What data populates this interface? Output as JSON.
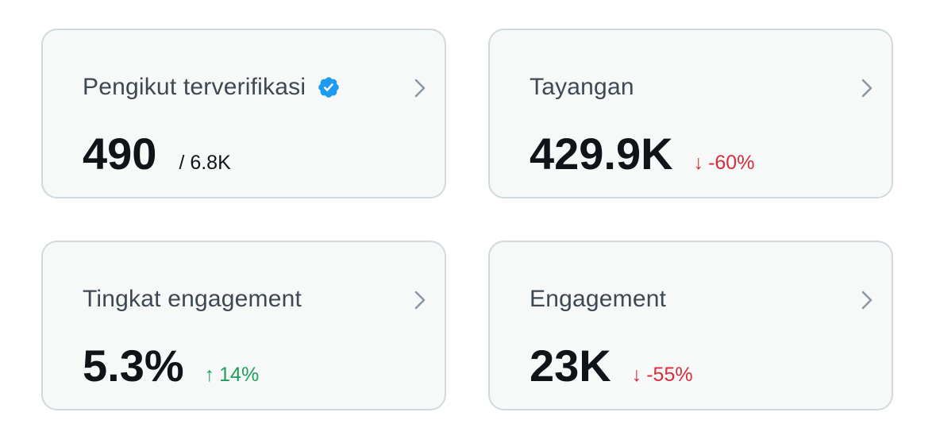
{
  "colors": {
    "card_background": "#f7f9f9",
    "card_border": "#cfd9de",
    "verified_blue": "#1d9bf0",
    "negative_red": "#d62c3b",
    "positive_green": "#1f9d5b",
    "chevron_gray": "#8b98a5"
  },
  "cards": [
    {
      "label": "Pengikut terverifikasi",
      "label_icon": "verified-badge-icon",
      "value": "490",
      "total": "/ 6.8K",
      "action_icon": "chevron-right-icon"
    },
    {
      "label": "Tayangan",
      "value": "429.9K",
      "change_arrow": "↓",
      "change_value": "-60%",
      "change_direction": "down",
      "action_icon": "chevron-right-icon"
    },
    {
      "label": "Tingkat engagement",
      "value": "5.3%",
      "change_arrow": "↑",
      "change_value": "14%",
      "change_direction": "up",
      "action_icon": "chevron-right-icon"
    },
    {
      "label": "Engagement",
      "value": "23K",
      "change_arrow": "↓",
      "change_value": "-55%",
      "change_direction": "down",
      "action_icon": "chevron-right-icon"
    }
  ]
}
